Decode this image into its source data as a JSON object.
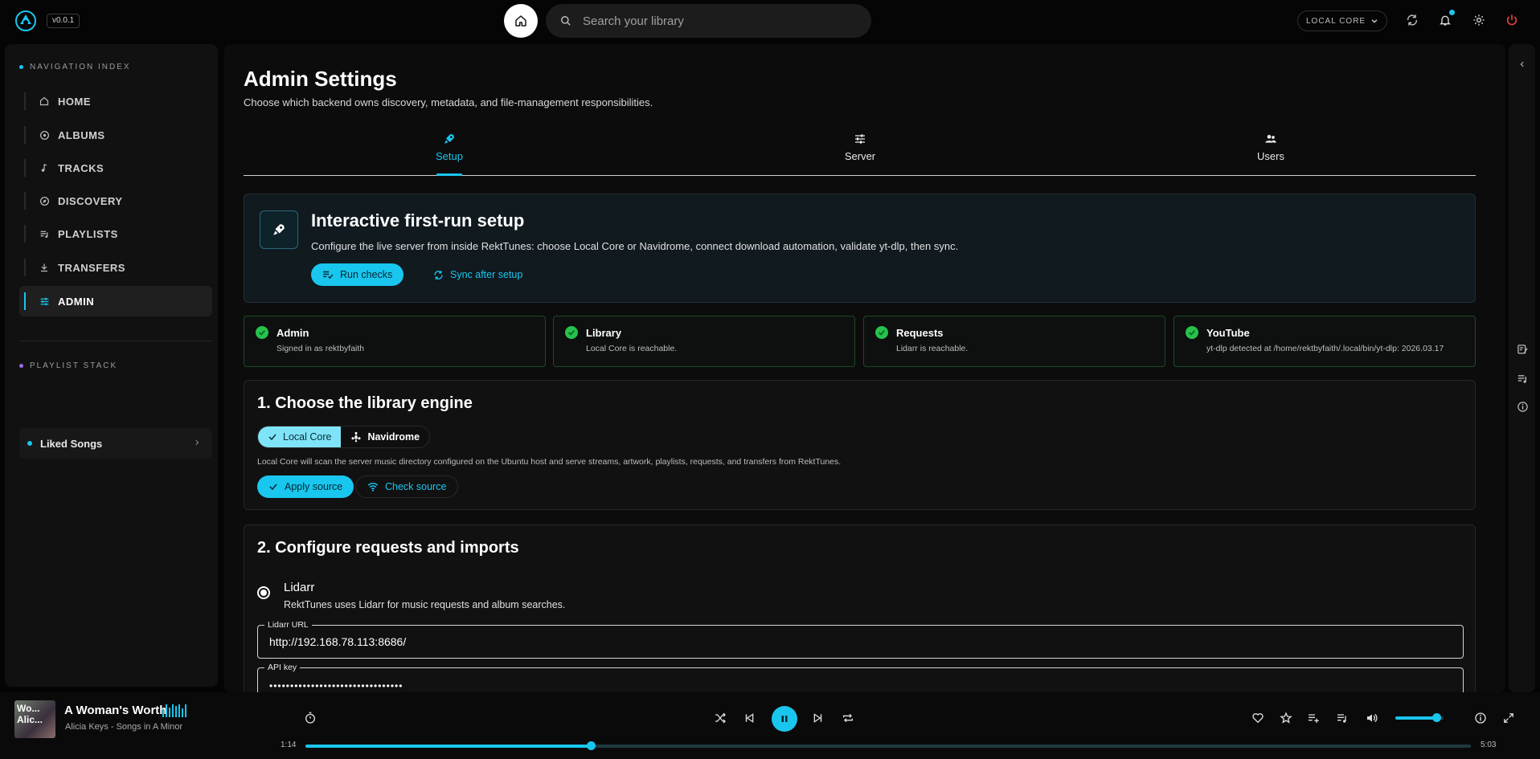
{
  "app": {
    "version": "v0.0.1"
  },
  "search": {
    "placeholder": "Search your library"
  },
  "topbar": {
    "server_select": "LOCAL CORE"
  },
  "sidebar": {
    "nav_label": "NAVIGATION INDEX",
    "items": [
      {
        "label": "HOME",
        "icon": "home-icon"
      },
      {
        "label": "ALBUMS",
        "icon": "album-icon"
      },
      {
        "label": "TRACKS",
        "icon": "music-note-icon"
      },
      {
        "label": "DISCOVERY",
        "icon": "compass-icon"
      },
      {
        "label": "PLAYLISTS",
        "icon": "playlist-icon"
      },
      {
        "label": "TRANSFERS",
        "icon": "download-icon"
      },
      {
        "label": "ADMIN",
        "icon": "sliders-icon"
      }
    ],
    "active": "ADMIN",
    "playlist_label": "PLAYLIST STACK",
    "playlists": [
      {
        "label": "Liked Songs"
      }
    ]
  },
  "page": {
    "title": "Admin Settings",
    "subtitle": "Choose which backend owns discovery, metadata, and file-management responsibilities.",
    "tabs": [
      {
        "label": "Setup"
      },
      {
        "label": "Server"
      },
      {
        "label": "Users"
      }
    ],
    "active_tab": "Setup"
  },
  "setup": {
    "title": "Interactive first-run setup",
    "description": "Configure the live server from inside RektTunes: choose Local Core or Navidrome, connect download automation, validate yt-dlp, then sync.",
    "run_checks": "Run checks",
    "sync_after": "Sync after setup"
  },
  "status_cards": [
    {
      "title": "Admin",
      "detail": "Signed in as rektbyfaith"
    },
    {
      "title": "Library",
      "detail": "Local Core is reachable."
    },
    {
      "title": "Requests",
      "detail": "Lidarr is reachable."
    },
    {
      "title": "YouTube",
      "detail": "yt-dlp detected at /home/rektbyfaith/.local/bin/yt-dlp: 2026.03.17"
    }
  ],
  "engine": {
    "heading": "1. Choose the library engine",
    "options": [
      {
        "label": "Local Core",
        "selected": true
      },
      {
        "label": "Navidrome",
        "selected": false
      }
    ],
    "description": "Local Core will scan the server music directory configured on the Ubuntu host and serve streams, artwork, playlists, requests, and transfers from RektTunes.",
    "apply": "Apply source",
    "check": "Check source"
  },
  "requests": {
    "heading": "2. Configure requests and imports",
    "provider": "Lidarr",
    "provider_desc": "RektTunes uses Lidarr for music requests and album searches.",
    "url_label": "Lidarr URL",
    "url_value": "http://192.168.78.113:8686/",
    "key_label": "API key",
    "key_value": "••••••••••••••••••••••••••••••••"
  },
  "player": {
    "title": "A Woman's Worth",
    "subtitle": "Alicia Keys - Songs in A Minor",
    "cover_text": "Wo... Alic...",
    "elapsed": "1:14",
    "duration": "5:03",
    "progress": 0.245,
    "volume": 0.85,
    "state": "playing"
  },
  "colors": {
    "accent": "#19c6ee",
    "success": "#27c24c",
    "danger": "#e8413a",
    "purple": "#9b6cf0"
  }
}
